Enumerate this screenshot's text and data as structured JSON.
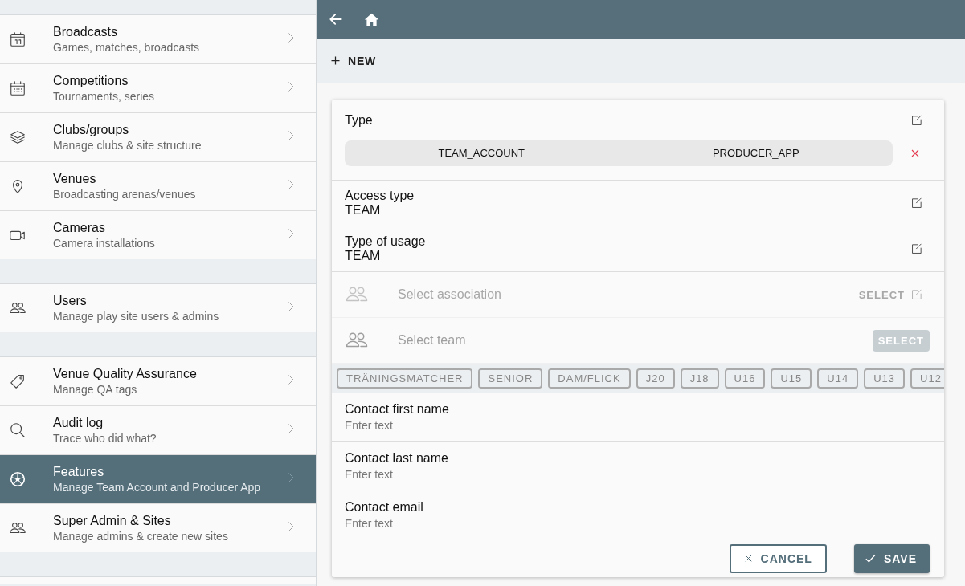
{
  "sidebar": {
    "groups": [
      {
        "items": [
          {
            "title": "Broadcasts",
            "subtitle": "Games, matches, broadcasts",
            "selected": false
          },
          {
            "title": "Competitions",
            "subtitle": "Tournaments, series",
            "selected": false
          },
          {
            "title": "Clubs/groups",
            "subtitle": "Manage clubs & site structure",
            "selected": false
          },
          {
            "title": "Venues",
            "subtitle": "Broadcasting arenas/venues",
            "selected": false
          },
          {
            "title": "Cameras",
            "subtitle": "Camera installations",
            "selected": false
          }
        ]
      },
      {
        "items": [
          {
            "title": "Users",
            "subtitle": "Manage play site users & admins",
            "selected": false
          }
        ]
      },
      {
        "items": [
          {
            "title": "Venue Quality Assurance",
            "subtitle": "Manage QA tags",
            "selected": false
          },
          {
            "title": "Audit log",
            "subtitle": "Trace who did what?",
            "selected": false
          },
          {
            "title": "Features",
            "subtitle": "Manage Team Account and Producer App",
            "selected": true
          },
          {
            "title": "Super Admin & Sites",
            "subtitle": "Manage admins & create new sites",
            "selected": false
          }
        ]
      }
    ]
  },
  "toolbar": {
    "new_button": "NEW"
  },
  "form": {
    "type": {
      "label": "Type",
      "values": [
        "TEAM_ACCOUNT",
        "PRODUCER_APP"
      ]
    },
    "fields": [
      {
        "label": "Access type",
        "value": "TEAM"
      },
      {
        "label": "Type of usage",
        "value": "TEAM"
      }
    ],
    "pickers": [
      {
        "placeholder": "Select association",
        "button": "SELECT",
        "disabled": true
      },
      {
        "placeholder": "Select team",
        "button": "SELECT",
        "disabled": false
      }
    ],
    "tags": [
      "TRÄNINGSMATCHER",
      "SENIOR",
      "DAM/FLICK",
      "J20",
      "J18",
      "U16",
      "U15",
      "U14",
      "U13",
      "U12"
    ],
    "contacts": [
      {
        "label": "Contact first name",
        "placeholder": "Enter text"
      },
      {
        "label": "Contact last name",
        "placeholder": "Enter text"
      },
      {
        "label": "Contact email",
        "placeholder": "Enter text"
      }
    ],
    "cancel_button": "CANCEL",
    "save_button": "SAVE"
  }
}
